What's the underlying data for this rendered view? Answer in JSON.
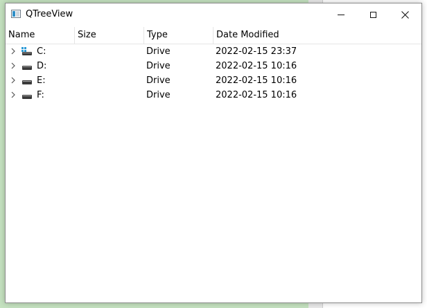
{
  "window": {
    "title": "QTreeView",
    "controls": {
      "minimize_icon": "minimize-icon",
      "maximize_icon": "maximize-icon",
      "close_icon": "close-icon"
    }
  },
  "tree": {
    "columns": [
      "Name",
      "Size",
      "Type",
      "Date Modified"
    ],
    "rows": [
      {
        "name": "C:",
        "size": "",
        "type": "Drive",
        "date_modified": "2022-02-15 23:37",
        "icon": "system-drive-icon"
      },
      {
        "name": "D:",
        "size": "",
        "type": "Drive",
        "date_modified": "2022-02-15 10:16",
        "icon": "drive-icon"
      },
      {
        "name": "E:",
        "size": "",
        "type": "Drive",
        "date_modified": "2022-02-15 10:16",
        "icon": "drive-icon"
      },
      {
        "name": "F:",
        "size": "",
        "type": "Drive",
        "date_modified": "2022-02-15 10:16",
        "icon": "drive-icon"
      }
    ]
  },
  "colors": {
    "desktop_background": "#c5e2c0",
    "window_border": "#8c8c8c",
    "accent_blue": "#2f8fc7"
  }
}
